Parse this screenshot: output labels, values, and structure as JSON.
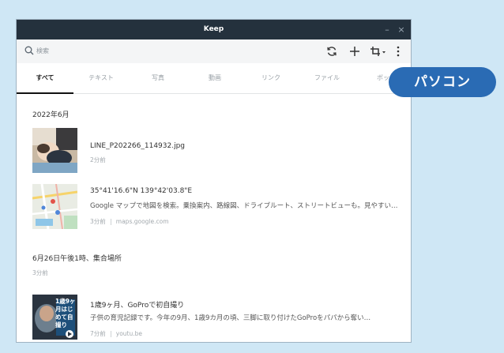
{
  "window": {
    "title": "Keep"
  },
  "toolbar": {
    "search_placeholder": "検索",
    "icons": [
      "refresh-icon",
      "plus-icon",
      "crop-icon",
      "more-icon"
    ]
  },
  "tabs": [
    {
      "label": "すべて",
      "active": true
    },
    {
      "label": "テキスト"
    },
    {
      "label": "写真"
    },
    {
      "label": "動画"
    },
    {
      "label": "リンク"
    },
    {
      "label": "ファイル"
    },
    {
      "label": "ボッ"
    }
  ],
  "sections": [
    {
      "title": "2022年6月",
      "items": [
        {
          "title": "LINE_P202266_114932.jpg",
          "time": "2分前"
        },
        {
          "title": "35°41'16.6\"N 139°42'03.8\"E",
          "desc": "Google マップで地図を検索。乗換案内、路線図、ドライブルート、ストリートビューも。見やすい…",
          "time": "3分前",
          "source": "maps.google.com"
        }
      ]
    },
    {
      "title": "6月26日午後1時、集合場所",
      "time": "3分前"
    },
    {
      "items": [
        {
          "title": "1歳9ヶ月、GoProで初自撮り",
          "desc": "子供の育児記録です。今年の9月、1歳9カ月の頃、三脚に取り付けたGoProをパパから奪い…",
          "time": "7分前",
          "source": "youtu.be",
          "thumb_text": "1歳9ヶ月はじめて自撮り"
        }
      ]
    }
  ],
  "badge": {
    "label": "パソコン"
  },
  "colors": {
    "titlebar": "#24313d",
    "badge": "#2a6bb4",
    "background": "#cfe7f5"
  }
}
